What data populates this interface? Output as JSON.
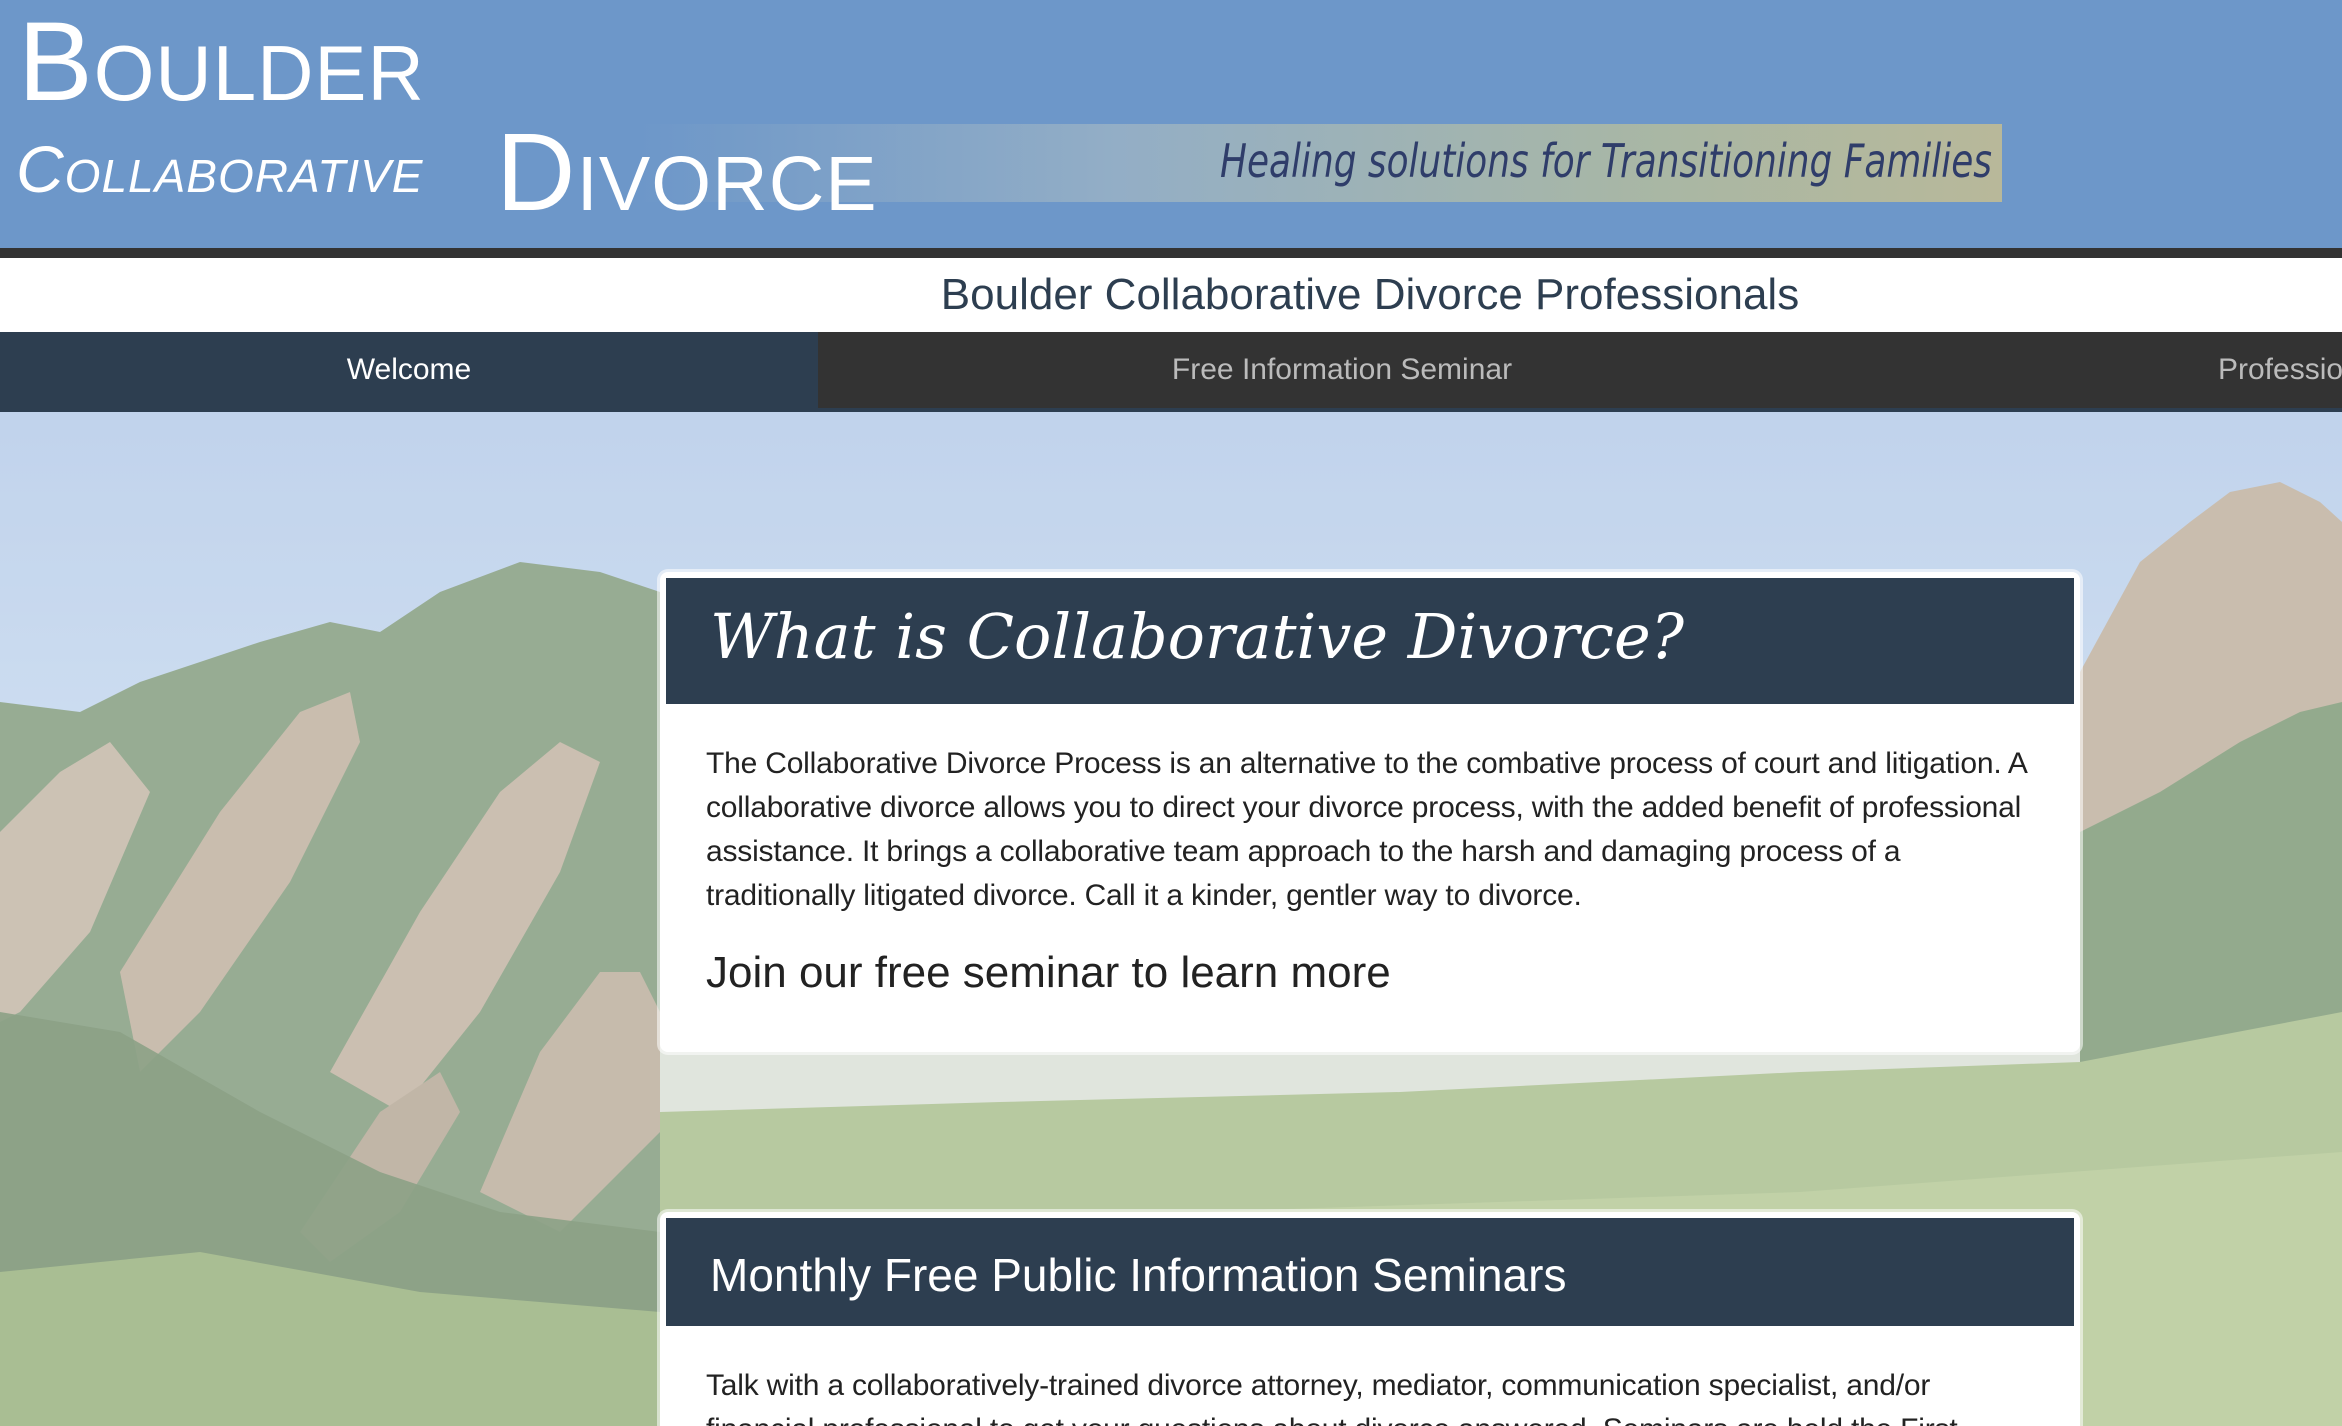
{
  "header": {
    "logo_line1": "Boulder",
    "logo_line2a": "Collaborative",
    "logo_line2b": "Divorce",
    "tagline": "Healing solutions for Transitioning Families"
  },
  "site_title": "Boulder Collaborative Divorce Professionals",
  "nav": {
    "items": [
      {
        "label": "Welcome",
        "active": true
      },
      {
        "label": "Free Information Seminar",
        "active": false
      },
      {
        "label": "Professio",
        "active": false
      }
    ]
  },
  "intro_card": {
    "title": "What is Collaborative Divorce?",
    "body": "The Collaborative Divorce Process is an alternative to the combative process of court and litigation. A collaborative divorce allows you to direct your divorce process, with the added benefit of professional assistance. It brings a collaborative team approach to the harsh and damaging process of a traditionally litigated divorce. Call it a kinder, gentler way to divorce.",
    "cta": "Join our free seminar to learn more"
  },
  "seminar_card": {
    "title": "Monthly Free Public Information Seminars",
    "body": "Talk with a collaboratively-trained divorce attorney, mediator, communication specialist, and/or financial professional to get your questions about divorce answered. Seminars are held the First"
  },
  "colors": {
    "banner": "#6d97c9",
    "nav_bg": "#333333",
    "nav_active": "#2d3e50",
    "card_head": "#2d3e50",
    "tagline": "#2f3d6a"
  }
}
